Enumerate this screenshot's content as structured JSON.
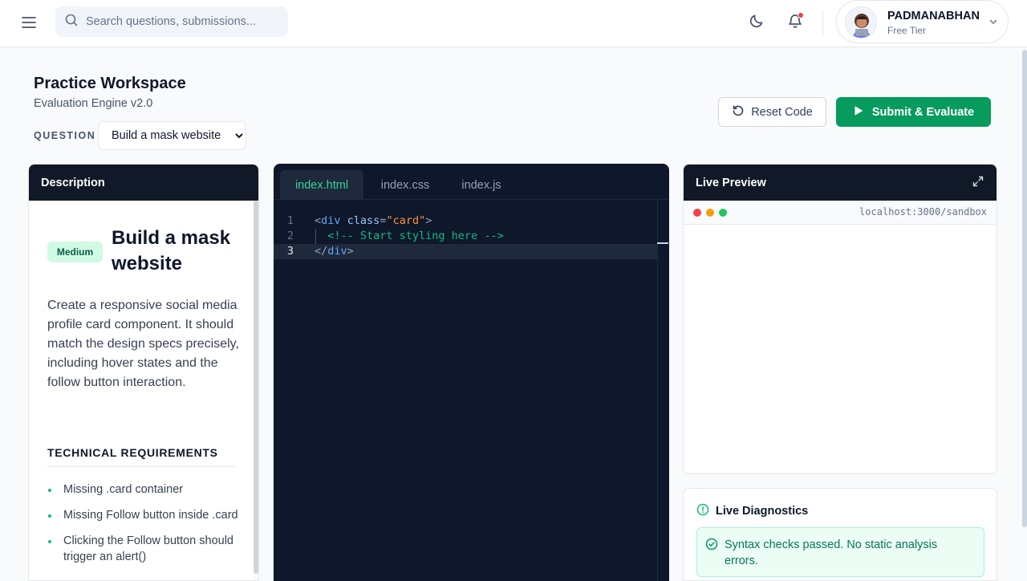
{
  "header": {
    "search_placeholder": "Search questions, submissions...",
    "user": {
      "name": "PADMANABHAN",
      "tier": "Free Tier"
    }
  },
  "page": {
    "title": "Practice Workspace",
    "subtitle": "Evaluation Engine v2.0",
    "question_label": "QUESTION",
    "question_options": [
      "Build a mask website"
    ],
    "question_selected": "Build a mask website",
    "reset_label": "Reset Code",
    "submit_label": "Submit & Evaluate"
  },
  "description": {
    "header": "Description",
    "difficulty": "Medium",
    "title": "Build a mask website",
    "body": "Create a responsive social media profile card component. It should match the design specs precisely, including hover states and the follow button interaction.",
    "requirements_heading": "TECHNICAL REQUIREMENTS",
    "requirements": [
      "Missing .card container",
      "Missing Follow button inside .card",
      "Clicking the Follow button should trigger an alert()"
    ]
  },
  "editor": {
    "tabs": [
      "index.html",
      "index.css",
      "index.js"
    ],
    "active_tab": "index.html",
    "line_numbers": [
      "1",
      "2",
      "3"
    ],
    "code": {
      "l1_open": "<",
      "l1_tag": "div",
      "l1_attr": " class",
      "l1_eq": "=",
      "l1_str": "\"card\"",
      "l1_close": ">",
      "l2_comment": "  <!-- Start styling here -->",
      "l3_open": "</",
      "l3_tag": "div",
      "l3_close": ">"
    },
    "current_line": 3
  },
  "preview": {
    "header": "Live Preview",
    "url": "localhost:3000/sandbox",
    "dot_colors": [
      "#ef4444",
      "#f59e0b",
      "#22c55e"
    ]
  },
  "diagnostics": {
    "title": "Live Diagnostics",
    "message": "Syntax checks passed. No static analysis errors."
  },
  "colors": {
    "accent": "#079b5e",
    "dark_header": "#111827",
    "editor_bg": "#0f172a"
  }
}
